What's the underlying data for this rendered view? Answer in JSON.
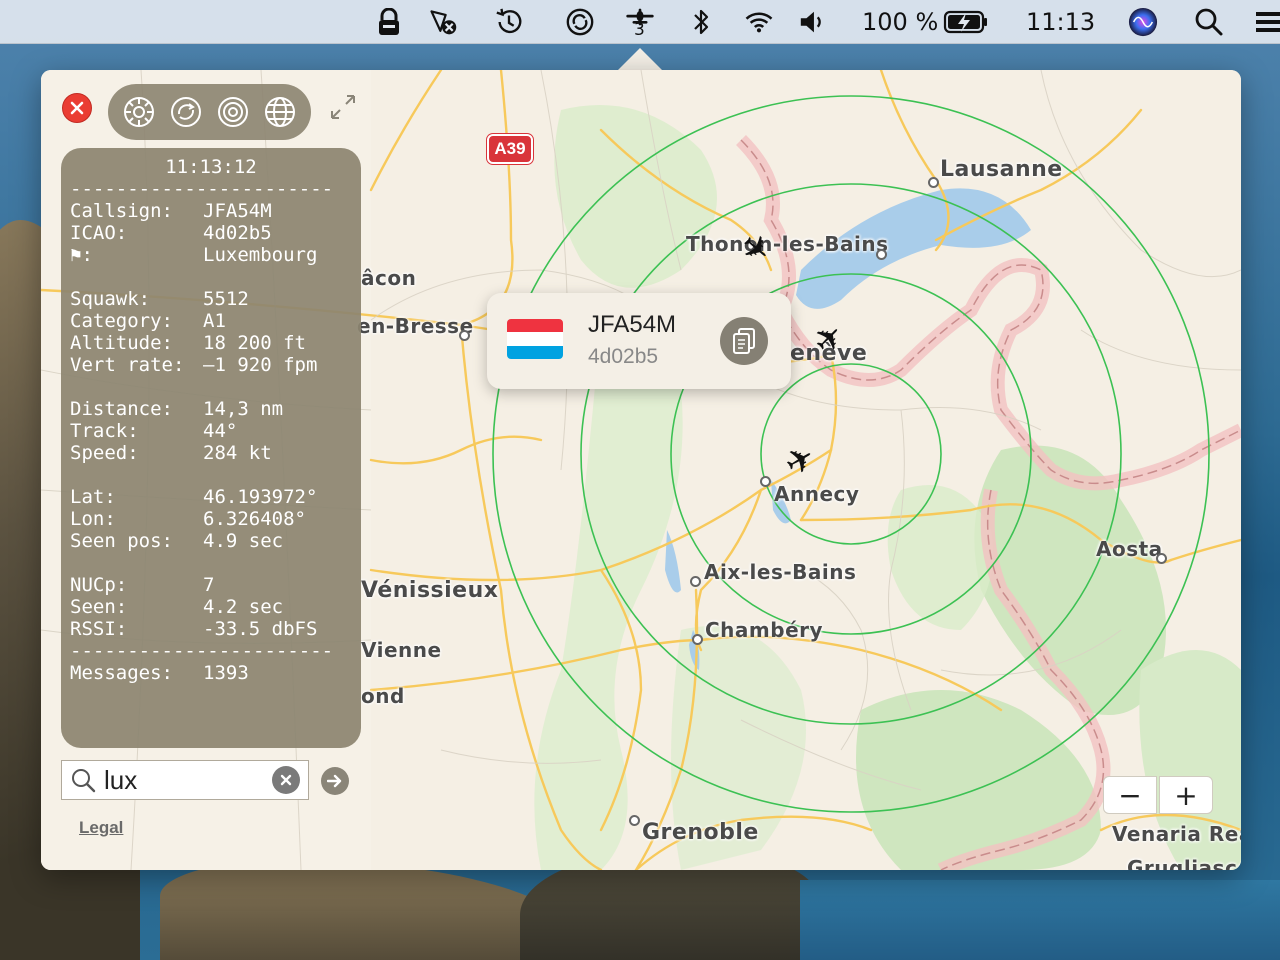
{
  "menubar": {
    "flights_count": "3",
    "battery_percent": "100 %",
    "clock": "11:13",
    "icons": [
      "lock-icon",
      "flight-tracker-icon",
      "time-machine-icon",
      "sync-icon",
      "plane-radar-icon",
      "bluetooth-icon",
      "wifi-icon",
      "volume-icon",
      "battery-icon",
      "siri-icon",
      "spotlight-icon",
      "control-center-icon"
    ]
  },
  "toolbar": {
    "icons": [
      "settings-icon",
      "sync-icon",
      "target-icon",
      "globe-icon"
    ]
  },
  "info": {
    "time": "11:13:12",
    "separator": "-----------------------",
    "rows1": [
      {
        "k": "Callsign:",
        "v": "JFA54M"
      },
      {
        "k": "ICAO:",
        "v": "4d02b5"
      },
      {
        "k": "⚑:",
        "v": "Luxembourg"
      }
    ],
    "rows2": [
      {
        "k": "Squawk:",
        "v": "5512"
      },
      {
        "k": "Category:",
        "v": "A1"
      },
      {
        "k": "Altitude:",
        "v": "18 200 ft"
      },
      {
        "k": "Vert rate:",
        "v": "–1 920 fpm"
      }
    ],
    "rows3": [
      {
        "k": "Distance:",
        "v": "14,3 nm"
      },
      {
        "k": "Track:",
        "v": "44°"
      },
      {
        "k": "Speed:",
        "v": "284 kt"
      }
    ],
    "rows4": [
      {
        "k": "Lat:",
        "v": "46.193972°"
      },
      {
        "k": "Lon:",
        "v": "6.326408°"
      },
      {
        "k": "Seen pos:",
        "v": "4.9 sec"
      }
    ],
    "rows5": [
      {
        "k": "NUCp:",
        "v": "7"
      },
      {
        "k": "Seen:",
        "v": "4.2 sec"
      },
      {
        "k": "RSSI:",
        "v": "-33.5 dbFS"
      }
    ],
    "messages": {
      "k": "Messages:",
      "v": "1393"
    }
  },
  "search": {
    "value": "lux"
  },
  "legal": "Legal",
  "callout": {
    "callsign": "JFA54M",
    "icao": "4d02b5",
    "flag_colors": [
      "#ef3340",
      "#ffffff",
      "#00a2e1"
    ]
  },
  "map": {
    "road_sign": "A39",
    "cities": {
      "lausanne": "Lausanne",
      "thonon": "Thonon-les-Bains",
      "macon": "âcon",
      "bresse": "en-Bresse",
      "geneve": "enève",
      "annecy": "Annecy",
      "aosta": "Aosta",
      "aix": "Aix-les-Bains",
      "venissieux": "Vénissieux",
      "chambery": "Chambéry",
      "vienne": "Vienne",
      "roussillon": "ond",
      "grenoble": "Grenoble",
      "venaria": "Venaria Rea",
      "grugliasco": "Grugliasco"
    }
  },
  "zoom": {
    "minus": "−",
    "plus": "+"
  }
}
